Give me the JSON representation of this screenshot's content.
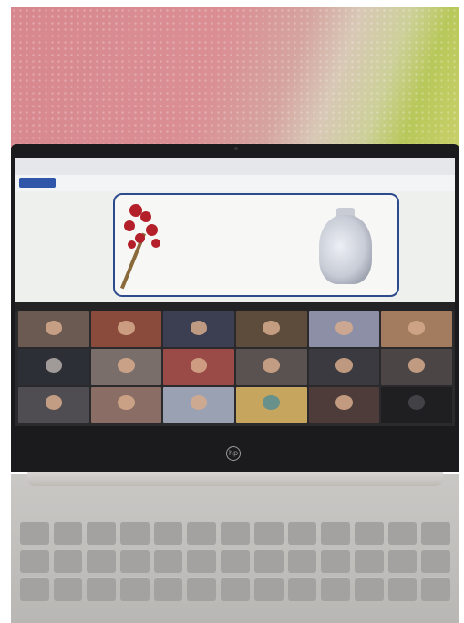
{
  "scene": {
    "description_type": "photo",
    "device_logo": "hp",
    "colors": {
      "wall": "#d7878e",
      "board_frame": "#2d4a8c",
      "bezel": "#1b1b1d",
      "laptop_deck": "#c4c2bf"
    }
  },
  "screen": {
    "participant_count": 18
  }
}
